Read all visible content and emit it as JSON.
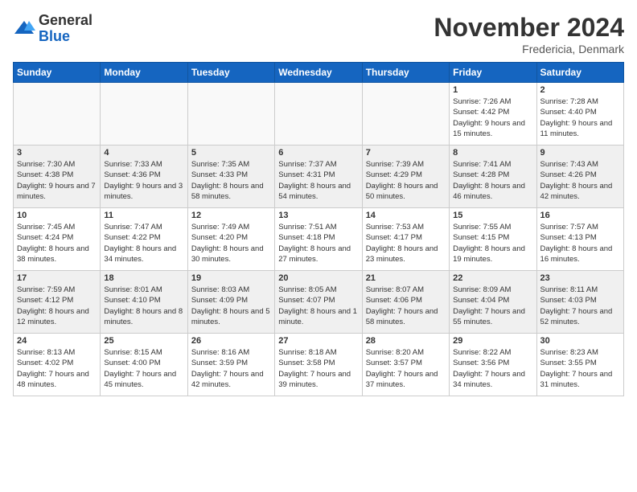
{
  "logo": {
    "general": "General",
    "blue": "Blue"
  },
  "header": {
    "month": "November 2024",
    "location": "Fredericia, Denmark"
  },
  "weekdays": [
    "Sunday",
    "Monday",
    "Tuesday",
    "Wednesday",
    "Thursday",
    "Friday",
    "Saturday"
  ],
  "weeks": [
    [
      {
        "day": "",
        "info": ""
      },
      {
        "day": "",
        "info": ""
      },
      {
        "day": "",
        "info": ""
      },
      {
        "day": "",
        "info": ""
      },
      {
        "day": "",
        "info": ""
      },
      {
        "day": "1",
        "info": "Sunrise: 7:26 AM\nSunset: 4:42 PM\nDaylight: 9 hours and 15 minutes."
      },
      {
        "day": "2",
        "info": "Sunrise: 7:28 AM\nSunset: 4:40 PM\nDaylight: 9 hours and 11 minutes."
      }
    ],
    [
      {
        "day": "3",
        "info": "Sunrise: 7:30 AM\nSunset: 4:38 PM\nDaylight: 9 hours and 7 minutes."
      },
      {
        "day": "4",
        "info": "Sunrise: 7:33 AM\nSunset: 4:36 PM\nDaylight: 9 hours and 3 minutes."
      },
      {
        "day": "5",
        "info": "Sunrise: 7:35 AM\nSunset: 4:33 PM\nDaylight: 8 hours and 58 minutes."
      },
      {
        "day": "6",
        "info": "Sunrise: 7:37 AM\nSunset: 4:31 PM\nDaylight: 8 hours and 54 minutes."
      },
      {
        "day": "7",
        "info": "Sunrise: 7:39 AM\nSunset: 4:29 PM\nDaylight: 8 hours and 50 minutes."
      },
      {
        "day": "8",
        "info": "Sunrise: 7:41 AM\nSunset: 4:28 PM\nDaylight: 8 hours and 46 minutes."
      },
      {
        "day": "9",
        "info": "Sunrise: 7:43 AM\nSunset: 4:26 PM\nDaylight: 8 hours and 42 minutes."
      }
    ],
    [
      {
        "day": "10",
        "info": "Sunrise: 7:45 AM\nSunset: 4:24 PM\nDaylight: 8 hours and 38 minutes."
      },
      {
        "day": "11",
        "info": "Sunrise: 7:47 AM\nSunset: 4:22 PM\nDaylight: 8 hours and 34 minutes."
      },
      {
        "day": "12",
        "info": "Sunrise: 7:49 AM\nSunset: 4:20 PM\nDaylight: 8 hours and 30 minutes."
      },
      {
        "day": "13",
        "info": "Sunrise: 7:51 AM\nSunset: 4:18 PM\nDaylight: 8 hours and 27 minutes."
      },
      {
        "day": "14",
        "info": "Sunrise: 7:53 AM\nSunset: 4:17 PM\nDaylight: 8 hours and 23 minutes."
      },
      {
        "day": "15",
        "info": "Sunrise: 7:55 AM\nSunset: 4:15 PM\nDaylight: 8 hours and 19 minutes."
      },
      {
        "day": "16",
        "info": "Sunrise: 7:57 AM\nSunset: 4:13 PM\nDaylight: 8 hours and 16 minutes."
      }
    ],
    [
      {
        "day": "17",
        "info": "Sunrise: 7:59 AM\nSunset: 4:12 PM\nDaylight: 8 hours and 12 minutes."
      },
      {
        "day": "18",
        "info": "Sunrise: 8:01 AM\nSunset: 4:10 PM\nDaylight: 8 hours and 8 minutes."
      },
      {
        "day": "19",
        "info": "Sunrise: 8:03 AM\nSunset: 4:09 PM\nDaylight: 8 hours and 5 minutes."
      },
      {
        "day": "20",
        "info": "Sunrise: 8:05 AM\nSunset: 4:07 PM\nDaylight: 8 hours and 1 minute."
      },
      {
        "day": "21",
        "info": "Sunrise: 8:07 AM\nSunset: 4:06 PM\nDaylight: 7 hours and 58 minutes."
      },
      {
        "day": "22",
        "info": "Sunrise: 8:09 AM\nSunset: 4:04 PM\nDaylight: 7 hours and 55 minutes."
      },
      {
        "day": "23",
        "info": "Sunrise: 8:11 AM\nSunset: 4:03 PM\nDaylight: 7 hours and 52 minutes."
      }
    ],
    [
      {
        "day": "24",
        "info": "Sunrise: 8:13 AM\nSunset: 4:02 PM\nDaylight: 7 hours and 48 minutes."
      },
      {
        "day": "25",
        "info": "Sunrise: 8:15 AM\nSunset: 4:00 PM\nDaylight: 7 hours and 45 minutes."
      },
      {
        "day": "26",
        "info": "Sunrise: 8:16 AM\nSunset: 3:59 PM\nDaylight: 7 hours and 42 minutes."
      },
      {
        "day": "27",
        "info": "Sunrise: 8:18 AM\nSunset: 3:58 PM\nDaylight: 7 hours and 39 minutes."
      },
      {
        "day": "28",
        "info": "Sunrise: 8:20 AM\nSunset: 3:57 PM\nDaylight: 7 hours and 37 minutes."
      },
      {
        "day": "29",
        "info": "Sunrise: 8:22 AM\nSunset: 3:56 PM\nDaylight: 7 hours and 34 minutes."
      },
      {
        "day": "30",
        "info": "Sunrise: 8:23 AM\nSunset: 3:55 PM\nDaylight: 7 hours and 31 minutes."
      }
    ]
  ]
}
